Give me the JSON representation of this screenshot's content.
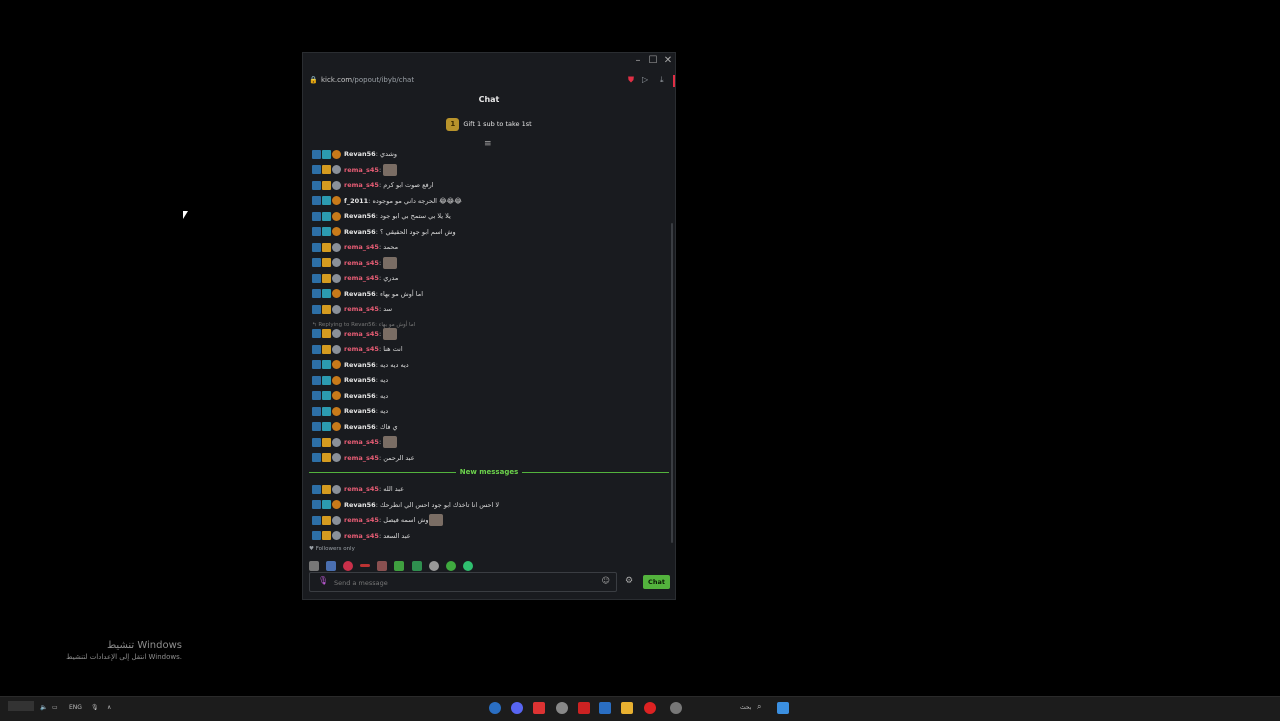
{
  "window": {
    "url_host": "kick.com",
    "url_path": "/popout/ibyb/chat",
    "chat_title": "Chat",
    "gift_badge": "1",
    "gift_text": "Gift 1 sub to take 1st"
  },
  "messages": [
    {
      "user": "Revan56",
      "text": "وشدي",
      "color": "white"
    },
    {
      "user": "rema_s45",
      "text": "",
      "color": "pink",
      "emote": true
    },
    {
      "user": "rema_s45",
      "text": "ارفع صوت ابو كرم",
      "color": "pink"
    },
    {
      "user": "f_2011",
      "text": "الحرجه داني مو موجوده 😂😂😂",
      "color": "white"
    },
    {
      "user": "Revan56",
      "text": "يلا يلا بي ستمح بي ابو جود",
      "color": "white"
    },
    {
      "user": "Revan56",
      "text": "وش اسم ابو جود الحقيقي ؟",
      "color": "white"
    },
    {
      "user": "rema_s45",
      "text": "محمد",
      "color": "pink"
    },
    {
      "user": "rema_s45",
      "text": "",
      "color": "pink",
      "emote": true
    },
    {
      "user": "rema_s45",
      "text": "مدري",
      "color": "pink"
    },
    {
      "user": "Revan56",
      "text": "اما أوش مو بهاء",
      "color": "white"
    },
    {
      "user": "rema_s45",
      "text": "سد",
      "color": "pink"
    },
    {
      "user": "rema_s45",
      "text": "",
      "color": "pink",
      "emote": true
    },
    {
      "user": "rema_s45",
      "text": "انت هنا",
      "color": "pink"
    },
    {
      "user": "Revan56",
      "text": "ديه ديه ديه",
      "color": "white"
    },
    {
      "user": "Revan56",
      "text": "ديه",
      "color": "white"
    },
    {
      "user": "Revan56",
      "text": "ديه",
      "color": "white"
    },
    {
      "user": "Revan56",
      "text": "ديه",
      "color": "white"
    },
    {
      "user": "Revan56",
      "text": "ي فاك",
      "color": "white"
    },
    {
      "user": "rema_s45",
      "text": "",
      "color": "pink",
      "emote": true
    },
    {
      "user": "rema_s45",
      "text": "عبد الرحمن",
      "color": "pink"
    }
  ],
  "reply": {
    "text": "Replying to Revan56:",
    "quote": "اما أوش مو بهاء"
  },
  "new_messages_label": "New messages",
  "new_messages": [
    {
      "user": "rema_s45",
      "text": "عبد الله",
      "color": "pink"
    },
    {
      "user": "Revan56",
      "text": "لا احس انا تاخذك ابو جود احس الي انطرحك",
      "color": "white"
    },
    {
      "user": "rema_s45",
      "text": "وش اسمه فيصل",
      "color": "pink",
      "emote": true
    },
    {
      "user": "rema_s45",
      "text": "عبد السعد",
      "color": "pink"
    }
  ],
  "followers_only": "Followers only",
  "input": {
    "placeholder": "Send a message"
  },
  "chat_button": "Chat",
  "activation": {
    "title": "تنشيط Windows",
    "subtitle": "انتقل إلى الإعدادات لتنشيط Windows."
  },
  "taskbar": {
    "lang": "ENG",
    "search": "بحث"
  }
}
